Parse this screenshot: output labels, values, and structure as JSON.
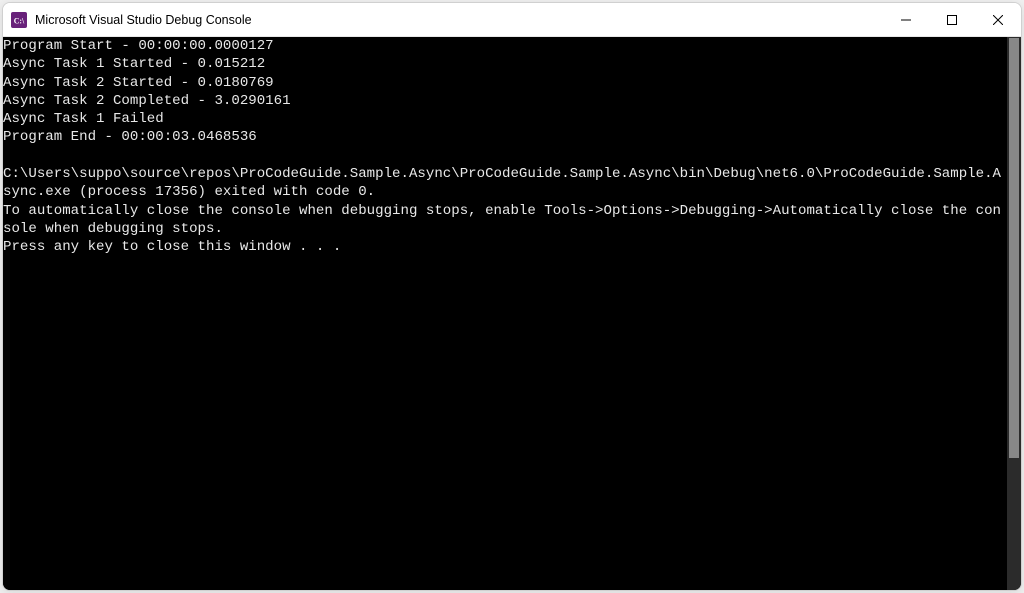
{
  "window": {
    "title": "Microsoft Visual Studio Debug Console"
  },
  "console": {
    "lines": [
      "Program Start - 00:00:00.0000127",
      "Async Task 1 Started - 0.015212",
      "Async Task 2 Started - 0.0180769",
      "Async Task 2 Completed - 3.0290161",
      "Async Task 1 Failed",
      "Program End - 00:00:03.0468536",
      "",
      "C:\\Users\\suppo\\source\\repos\\ProCodeGuide.Sample.Async\\ProCodeGuide.Sample.Async\\bin\\Debug\\net6.0\\ProCodeGuide.Sample.Async.exe (process 17356) exited with code 0.",
      "To automatically close the console when debugging stops, enable Tools->Options->Debugging->Automatically close the console when debugging stops.",
      "Press any key to close this window . . ."
    ]
  }
}
